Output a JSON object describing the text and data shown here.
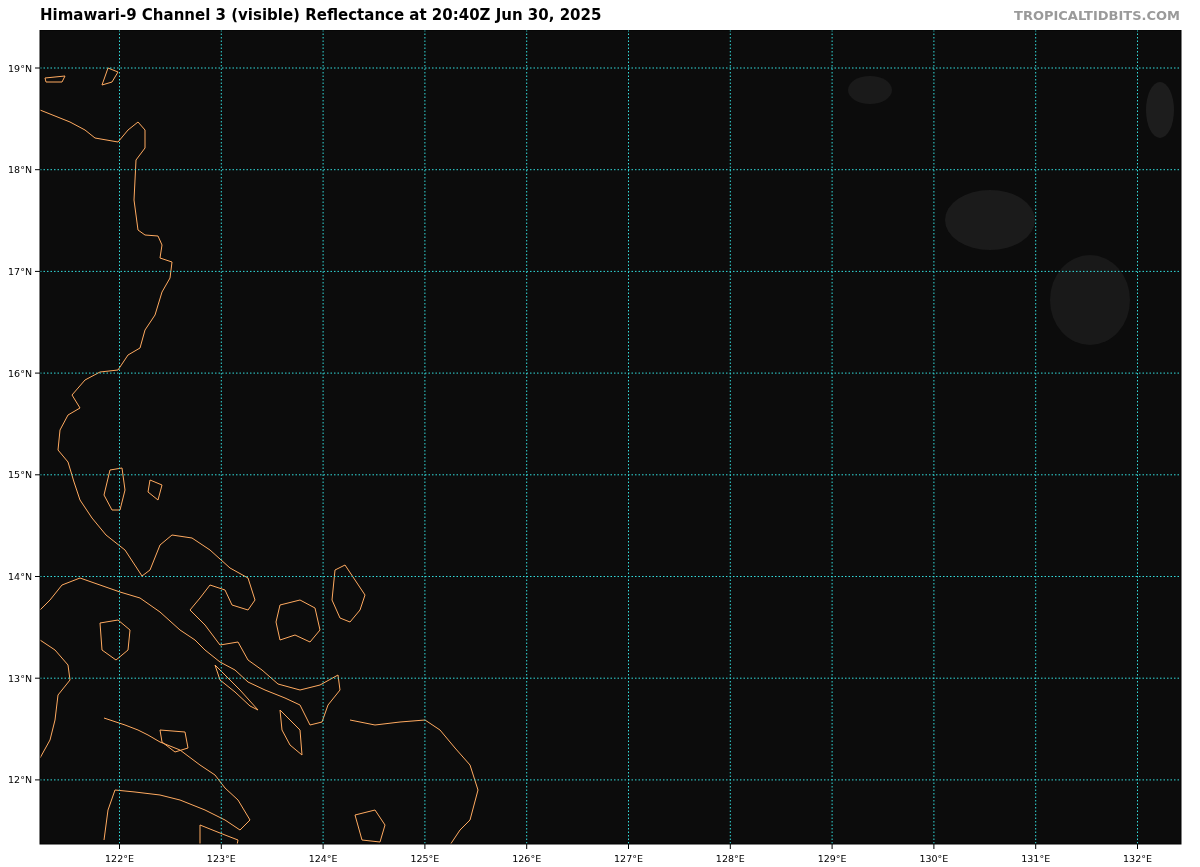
{
  "title": "Himawari-9 Channel 3 (visible) Reflectance at 20:40Z Jun 30, 2025",
  "credit": "TROPICALTIDBITS.COM",
  "map": {
    "lat_labels": [
      "19°N",
      "18°N",
      "17°N",
      "16°N",
      "15°N",
      "14°N",
      "13°N",
      "12°N"
    ],
    "lon_labels": [
      "122°E",
      "123°E",
      "124°E",
      "125°E",
      "126°E",
      "127°E",
      "128°E",
      "129°E",
      "130°E",
      "131°E",
      "132°E"
    ]
  }
}
